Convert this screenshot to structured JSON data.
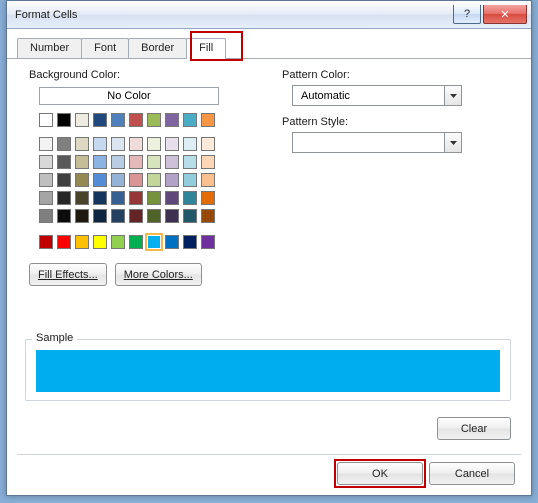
{
  "window": {
    "title": "Format Cells"
  },
  "tabs": {
    "number": "Number",
    "font": "Font",
    "border": "Border",
    "fill": "Fill"
  },
  "fill": {
    "bg_label": "Background Color:",
    "no_color": "No Color",
    "fill_effects": "Fill Effects...",
    "more_colors": "More Colors...",
    "pattern_color_label": "Pattern Color:",
    "pattern_color_value": "Automatic",
    "pattern_style_label": "Pattern Style:",
    "pattern_style_value": "",
    "selected_color": "#00aeef"
  },
  "sample": {
    "label": "Sample"
  },
  "buttons": {
    "clear": "Clear",
    "ok": "OK",
    "cancel": "Cancel"
  },
  "palette_theme_row": [
    "#ffffff",
    "#000000",
    "#eeece1",
    "#1f497d",
    "#4f81bd",
    "#c0504d",
    "#9bbb59",
    "#8064a2",
    "#4bacc6",
    "#f79646"
  ],
  "palette_tints": [
    [
      "#f2f2f2",
      "#7f7f7f",
      "#ddd9c3",
      "#c6d9f0",
      "#dbe5f1",
      "#f2dcdb",
      "#ebf1dd",
      "#e5e0ec",
      "#dbeef3",
      "#fdeada"
    ],
    [
      "#d8d8d8",
      "#595959",
      "#c4bd97",
      "#8db3e2",
      "#b8cce4",
      "#e5b9b7",
      "#d7e3bc",
      "#ccc1d9",
      "#b7dde8",
      "#fbd5b5"
    ],
    [
      "#bfbfbf",
      "#3f3f3f",
      "#938953",
      "#548dd4",
      "#95b3d7",
      "#d99694",
      "#c3d69b",
      "#b2a2c7",
      "#92cddc",
      "#fac08f"
    ],
    [
      "#a5a5a5",
      "#262626",
      "#494429",
      "#17365d",
      "#366092",
      "#953734",
      "#76923c",
      "#5f497a",
      "#31859b",
      "#e36c09"
    ],
    [
      "#7f7f7f",
      "#0c0c0c",
      "#1d1b10",
      "#0f243e",
      "#244061",
      "#632423",
      "#4f6228",
      "#3f3151",
      "#205867",
      "#974806"
    ]
  ],
  "palette_standard": [
    "#c00000",
    "#ff0000",
    "#ffc000",
    "#ffff00",
    "#92d050",
    "#00b050",
    "#00b0f0",
    "#0070c0",
    "#002060",
    "#7030a0"
  ]
}
